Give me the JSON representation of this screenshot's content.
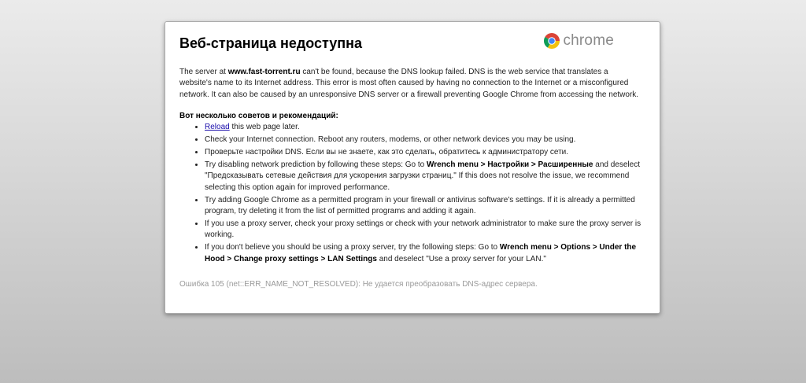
{
  "page": {
    "title": "Веб-страница недоступна",
    "brand": "chrome"
  },
  "summary": {
    "prefix": "The server at ",
    "host": "www.fast-torrent.ru",
    "suffix": " can't be found, because the DNS lookup failed. DNS is the web service that translates a website's name to its Internet address. This error is most often caused by having no connection to the Internet or a misconfigured network. It can also be caused by an unresponsive DNS server or a firewall preventing Google Chrome from accessing the network."
  },
  "tips": {
    "heading": "Вот несколько советов и рекомендаций:",
    "reload_link": "Reload",
    "reload_rest": " this web page later.",
    "tip2": "Check your Internet connection. Reboot any routers, modems, or other network devices you may be using.",
    "tip3": "Проверьте настройки DNS. Если вы не знаете, как это сделать, обратитесь к администратору сети.",
    "tip4_a": "Try disabling network prediction by following these steps: Go to ",
    "tip4_b": "Wrench menu > Настройки > Расширенные",
    "tip4_c": " and deselect \"Предсказывать сетевые действия для ускорения загрузки страниц.\" If this does not resolve the issue, we recommend selecting this option again for improved performance.",
    "tip5": "Try adding Google Chrome as a permitted program in your firewall or antivirus software's settings. If it is already a permitted program, try deleting it from the list of permitted programs and adding it again.",
    "tip6": "If you use a proxy server, check your proxy settings or check with your network administrator to make sure the proxy server is working.",
    "tip7_a": "If you don't believe you should be using a proxy server, try the following steps: Go to ",
    "tip7_b": "Wrench menu > Options > Under the Hood > Change proxy settings > LAN Settings",
    "tip7_c": " and deselect \"Use a proxy server for your LAN.\""
  },
  "error": {
    "text": "Ошибка 105 (net::ERR_NAME_NOT_RESOLVED): Не удается преобразовать DNS-адрес сервера."
  },
  "colors": {
    "link": "#1a0dab",
    "error_text": "#999999",
    "chrome_red": "#db4437",
    "chrome_yellow": "#f4c20d",
    "chrome_green": "#0f9d58",
    "chrome_blue": "#4285f4"
  },
  "icons": {
    "brand_logo": "chrome-logo-icon"
  }
}
